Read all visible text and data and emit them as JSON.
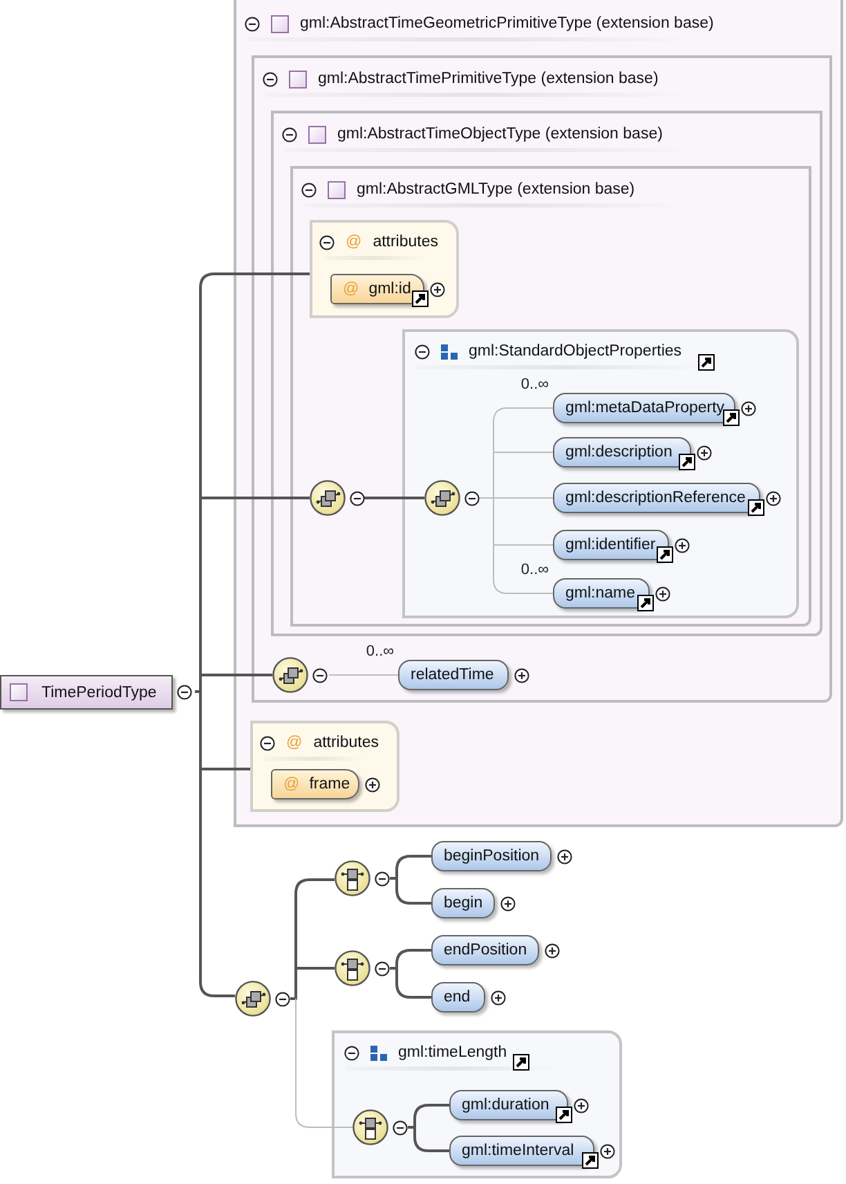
{
  "nodes": [
    {
      "kind": "container",
      "title": "gml:AbstractTimeGeometricPrimitiveType (extension base)",
      "expanded": true
    },
    {
      "kind": "container",
      "title": "gml:AbstractTimePrimitiveType (extension base)",
      "expanded": true
    },
    {
      "kind": "container",
      "title": "gml:AbstractTimeObjectType (extension base)",
      "expanded": true
    },
    {
      "kind": "container",
      "title": "gml:AbstractGMLType (extension base)",
      "expanded": true
    },
    {
      "kind": "attributes",
      "marker": "@",
      "title": "attributes",
      "expanded": true
    },
    {
      "kind": "attribute",
      "marker": "@",
      "name": "gml:id",
      "reference": true,
      "expanded": false
    },
    {
      "kind": "sequence",
      "expanded": true
    },
    {
      "kind": "group",
      "title": "gml:StandardObjectProperties",
      "reference": true,
      "expanded": true
    },
    {
      "kind": "sequence",
      "expanded": true
    },
    {
      "kind": "element",
      "name": "gml:metaDataProperty",
      "cardinality": "0..∞",
      "reference": true,
      "expanded": false
    },
    {
      "kind": "element",
      "name": "gml:description",
      "reference": true,
      "expanded": false
    },
    {
      "kind": "element",
      "name": "gml:descriptionReference",
      "reference": true,
      "expanded": false
    },
    {
      "kind": "element",
      "name": "gml:identifier",
      "reference": true,
      "expanded": false
    },
    {
      "kind": "element",
      "name": "gml:name",
      "cardinality": "0..∞",
      "reference": true,
      "expanded": false
    },
    {
      "kind": "root",
      "name": "TimePeriodType",
      "expanded": true
    },
    {
      "kind": "sequence",
      "expanded": true
    },
    {
      "kind": "element",
      "name": "relatedTime",
      "cardinality": "0..∞",
      "reference": false,
      "expanded": false
    },
    {
      "kind": "attributes",
      "marker": "@",
      "title": "attributes",
      "expanded": true
    },
    {
      "kind": "attribute",
      "marker": "@",
      "name": "frame",
      "reference": false,
      "expanded": false
    },
    {
      "kind": "sequence",
      "expanded": true
    },
    {
      "kind": "choice",
      "expanded": true
    },
    {
      "kind": "element",
      "name": "beginPosition",
      "reference": false,
      "expanded": false
    },
    {
      "kind": "element",
      "name": "begin",
      "reference": false,
      "expanded": false
    },
    {
      "kind": "choice",
      "expanded": true
    },
    {
      "kind": "element",
      "name": "endPosition",
      "reference": false,
      "expanded": false
    },
    {
      "kind": "element",
      "name": "end",
      "reference": false,
      "expanded": false
    },
    {
      "kind": "group",
      "title": "gml:timeLength",
      "reference": true,
      "expanded": true
    },
    {
      "kind": "choice",
      "expanded": true
    },
    {
      "kind": "element",
      "name": "gml:duration",
      "reference": true,
      "expanded": false
    },
    {
      "kind": "element",
      "name": "gml:timeInterval",
      "reference": true,
      "expanded": false
    }
  ]
}
